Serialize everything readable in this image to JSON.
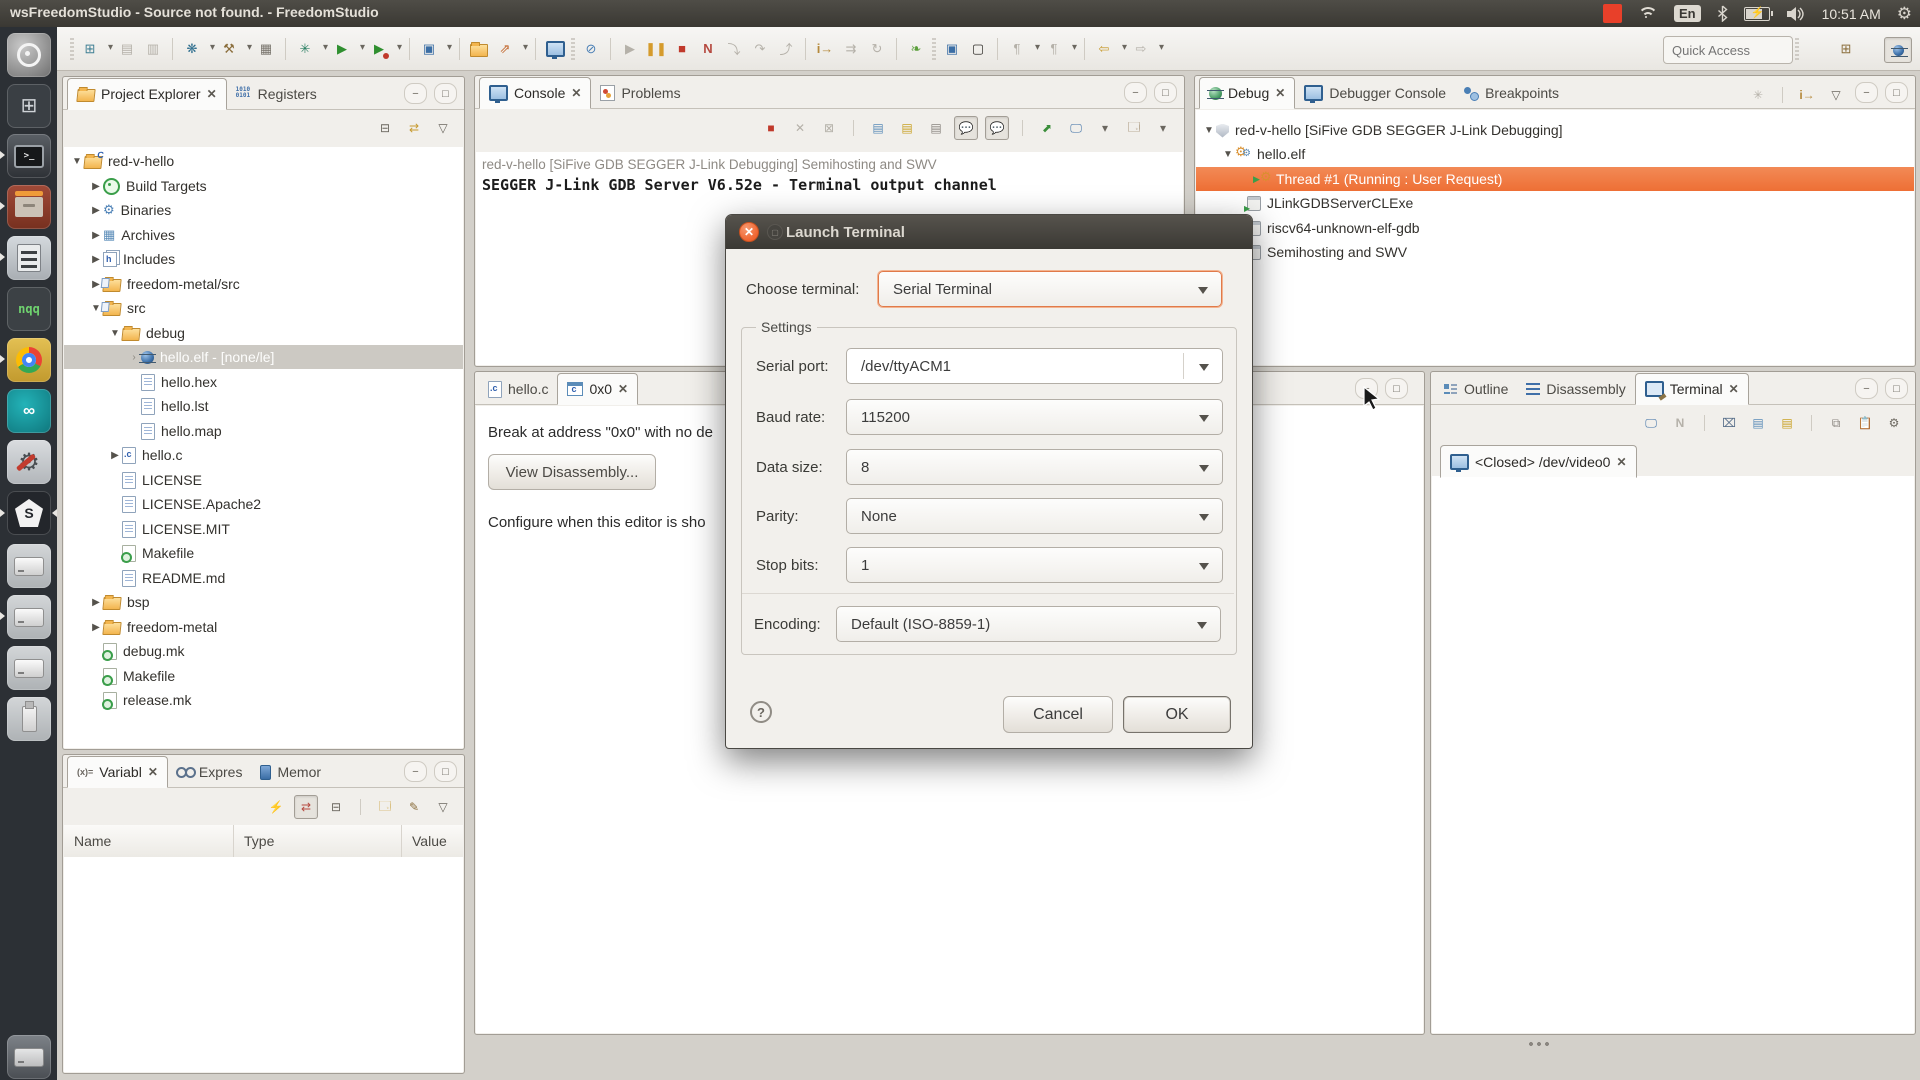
{
  "topbar": {
    "title": "wsFreedomStudio - Source not found. - FreedomStudio",
    "keyboard_layout": "En",
    "clock": "10:51 AM",
    "tray_icons": [
      "screen-record-indicator",
      "wifi-icon",
      "keyboard-layout",
      "bluetooth-icon",
      "battery-icon",
      "volume-icon",
      "clock",
      "session-gear-icon"
    ]
  },
  "dock": {
    "icons": [
      "dash-home",
      "workspace-switcher",
      "terminal-app",
      "archive-manager",
      "calculator-app",
      "notepadqq-app",
      "chrome-app",
      "arduino-app",
      "build-settings-app",
      "freedomstudio-app",
      "hard-drive-1",
      "hard-drive-2",
      "hard-drive-3",
      "usb-drive",
      "device-bottom"
    ],
    "nqq_label": "nqq",
    "sifive_label": "S"
  },
  "toolbar": {
    "quick_access_placeholder": "Quick Access",
    "icons": [
      "new-wizard",
      "save",
      "save-all",
      "flash-target",
      "build",
      "binary-utils",
      "debug-launch",
      "run-launch",
      "external-tools",
      "new-project",
      "open-folder",
      "launch-bar",
      "open-console",
      "skip-all-breakpoints",
      "resume",
      "suspend",
      "terminate",
      "disconnect",
      "step-into",
      "step-over",
      "step-return",
      "instruction-step",
      "instruction-over",
      "instruction-return",
      "trace",
      "sprobe",
      "memory-box",
      "pin-a",
      "pin-b",
      "back-history",
      "forward-history",
      "open-perspective",
      "debug-perspective"
    ]
  },
  "project_explorer": {
    "tabs": [
      {
        "label": "Project Explorer"
      },
      {
        "label": "Registers"
      }
    ],
    "tree": [
      {
        "label": "red-v-hello"
      },
      {
        "label": "Build Targets"
      },
      {
        "label": "Binaries"
      },
      {
        "label": "Archives"
      },
      {
        "label": "Includes"
      },
      {
        "label": "freedom-metal/src"
      },
      {
        "label": "src"
      },
      {
        "label": "debug"
      },
      {
        "label": "hello.elf - [none/le]"
      },
      {
        "label": "hello.hex"
      },
      {
        "label": "hello.lst"
      },
      {
        "label": "hello.map"
      },
      {
        "label": "hello.c"
      },
      {
        "label": "LICENSE"
      },
      {
        "label": "LICENSE.Apache2"
      },
      {
        "label": "LICENSE.MIT"
      },
      {
        "label": "Makefile"
      },
      {
        "label": "README.md"
      },
      {
        "label": "bsp"
      },
      {
        "label": "freedom-metal"
      },
      {
        "label": "debug.mk"
      },
      {
        "label": "Makefile"
      },
      {
        "label": "release.mk"
      }
    ]
  },
  "console": {
    "tabs": [
      {
        "label": "Console"
      },
      {
        "label": "Problems"
      }
    ],
    "header_line": "red-v-hello [SiFive GDB SEGGER J-Link Debugging] Semihosting and SWV",
    "output_line": "SEGGER J-Link GDB Server V6.52e - Terminal output channel"
  },
  "editor": {
    "tabs": [
      {
        "label": "hello.c"
      },
      {
        "label": "0x0"
      }
    ],
    "break_message": "Break at address \"0x0\" with no de",
    "view_disassembly_label": "View Disassembly...",
    "configure_message": "Configure when this editor is sho"
  },
  "debug": {
    "tabs": [
      {
        "label": "Debug"
      },
      {
        "label": "Debugger Console"
      },
      {
        "label": "Breakpoints"
      }
    ],
    "tree": [
      {
        "label": "red-v-hello [SiFive GDB SEGGER J-Link Debugging]"
      },
      {
        "label": "hello.elf"
      },
      {
        "label": "Thread #1 (Running : User Request)"
      },
      {
        "label": "JLinkGDBServerCLExe"
      },
      {
        "label": "riscv64-unknown-elf-gdb"
      },
      {
        "label": "Semihosting and SWV"
      }
    ]
  },
  "right_panel": {
    "tabs": [
      {
        "label": "Outline"
      },
      {
        "label": "Disassembly"
      },
      {
        "label": "Terminal"
      }
    ],
    "terminal_session_tab": "<Closed> /dev/video0"
  },
  "variables": {
    "tabs": [
      {
        "label": "Variabl"
      },
      {
        "label": "Expres"
      },
      {
        "label": "Memor"
      }
    ],
    "columns": [
      {
        "label": "Name"
      },
      {
        "label": "Type"
      },
      {
        "label": "Value"
      }
    ]
  },
  "dialog": {
    "title": "Launch Terminal",
    "choose_terminal_label": "Choose terminal:",
    "choose_terminal_value": "Serial Terminal",
    "settings_label": "Settings",
    "fields": [
      {
        "label": "Serial port:",
        "value": "/dev/ttyACM1"
      },
      {
        "label": "Baud rate:",
        "value": "115200"
      },
      {
        "label": "Data size:",
        "value": "8"
      },
      {
        "label": "Parity:",
        "value": "None"
      },
      {
        "label": "Stop bits:",
        "value": "1"
      }
    ],
    "encoding_label": "Encoding:",
    "encoding_value": "Default (ISO-8859-1)",
    "help_label": "?",
    "cancel_label": "Cancel",
    "ok_label": "OK"
  },
  "colors": {
    "selection_orange": "#ee6f35",
    "titlebar_dark": "#3b3934",
    "selection_gray": "#ccc9c3"
  }
}
